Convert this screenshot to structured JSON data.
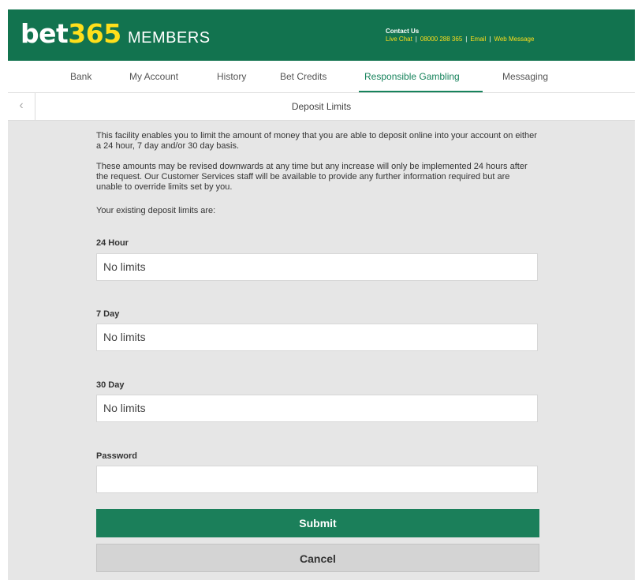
{
  "header": {
    "logo_bet": "bet",
    "logo_num": "365",
    "members": "MEMBERS",
    "contact_title": "Contact Us",
    "contact_links": [
      "Live Chat",
      "08000 288 365",
      "Email",
      "Web Message"
    ]
  },
  "nav": {
    "tabs": [
      {
        "label": "Bank"
      },
      {
        "label": "My Account"
      },
      {
        "label": "History"
      },
      {
        "label": "Bet Credits"
      },
      {
        "label": "Responsible Gambling"
      },
      {
        "label": "Messaging"
      }
    ],
    "active": "Responsible Gambling"
  },
  "subheader": {
    "title": "Deposit Limits",
    "back_icon": "‹"
  },
  "body": {
    "intro_1": "This facility enables you to limit the amount of money that you are able to deposit online into your account on either a 24 hour, 7 day and/or 30 day basis.",
    "intro_2": "These amounts may be revised downwards at any time but any increase will only be implemented 24 hours after the request. Our Customer Services staff will be available to provide any further information required but are unable to override limits set by you.",
    "intro_3": "Your existing deposit limits are:"
  },
  "limits": {
    "h24_label": "24 Hour",
    "h24_value": "No limits",
    "d7_label": "7 Day",
    "d7_value": "No limits",
    "d30_label": "30 Day",
    "d30_value": "No limits"
  },
  "password": {
    "label": "Password",
    "value": ""
  },
  "buttons": {
    "submit": "Submit",
    "cancel": "Cancel"
  },
  "colors": {
    "brand_green": "#12734f",
    "accent_yellow": "#ffdf1b",
    "active_tab": "#17835c"
  }
}
